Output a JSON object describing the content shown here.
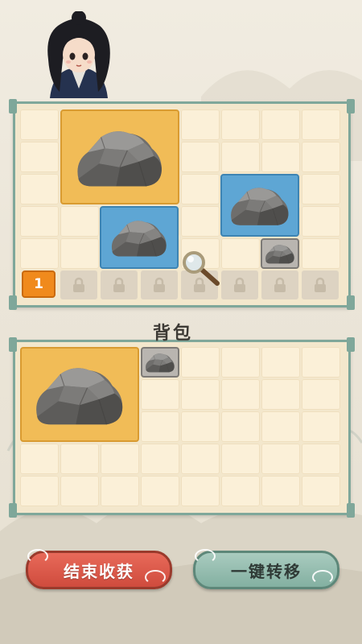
{
  "character": {
    "icon": "character-avatar"
  },
  "harvest_panel": {
    "badge": "1",
    "locked_slots": 7,
    "magnifier_icon": "magnifier-icon"
  },
  "backpack": {
    "title": "背包"
  },
  "buttons": {
    "end_harvest": "结束收获",
    "transfer_all": "一键转移"
  },
  "colors": {
    "panel_border": "#7fa79a",
    "gold_tile": "#f1bc57",
    "blue_tile": "#5ea6d4",
    "red_button": "#d9574a",
    "green_button": "#94bdb0"
  }
}
